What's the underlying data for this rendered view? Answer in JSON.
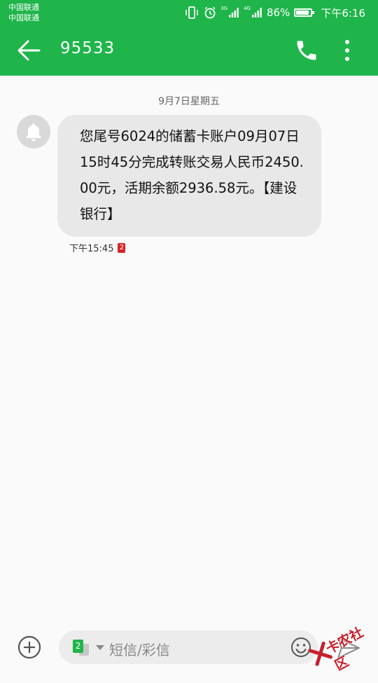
{
  "statusbar": {
    "carrier1": "中国联通",
    "carrier2": "中国联通",
    "net1_label": "3G",
    "net2_label": "4G",
    "battery_pct": "86%",
    "battery_level": 0.86,
    "time": "下午6:16",
    "icons": [
      "vibrate-icon",
      "alarm-icon",
      "signal-icon",
      "signal-icon",
      "battery-icon"
    ]
  },
  "appbar": {
    "title": "95533",
    "icons": [
      "back-arrow-icon",
      "phone-icon",
      "more-vertical-icon"
    ]
  },
  "conversation": {
    "date": "9月7日星期五",
    "message": {
      "text": "您尾号6024的储蓄卡账户09月07日15时45分完成转账交易人民币2450.00元，活期余额2936.58元。【建设银行】",
      "time": "下午15:45",
      "sim": "2",
      "avatar_icon": "bell-icon"
    }
  },
  "composer": {
    "sim": "2",
    "placeholder": "短信/彩信",
    "icons": [
      "add-circle-icon",
      "sim-card-icon",
      "chevron-down-icon",
      "emoji-icon",
      "send-icon"
    ]
  },
  "watermark": {
    "text": "卡农社区"
  },
  "colors": {
    "brand_green": "#1fb54a",
    "bubble_bg": "#e8e8e8",
    "background": "#fafafa",
    "sim_badge_red": "#d3262a",
    "watermark_red": "#c7202d"
  }
}
